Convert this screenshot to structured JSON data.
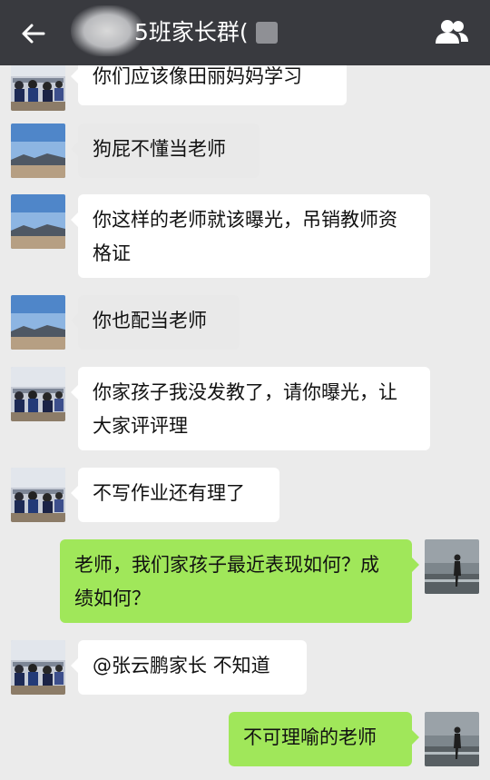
{
  "header": {
    "title": "5班家长群(",
    "back_icon": "back-arrow-icon",
    "members_icon": "group-members-icon"
  },
  "messages": [
    {
      "side": "left",
      "avatar": "classroom-avatar",
      "text": "你们应该像田丽妈妈学习"
    },
    {
      "side": "left",
      "avatar": "landscape-avatar",
      "text": "狗屁不懂当老师"
    },
    {
      "side": "left",
      "avatar": "landscape-avatar",
      "text": "你这样的老师就该曝光，吊销教师资格证"
    },
    {
      "side": "left",
      "avatar": "landscape-avatar",
      "text": "你也配当老师"
    },
    {
      "side": "left",
      "avatar": "classroom-avatar",
      "text": "你家孩子我没发教了，请你曝光，让大家评评理"
    },
    {
      "side": "left",
      "avatar": "classroom-avatar",
      "text": "不写作业还有理了"
    },
    {
      "side": "right",
      "avatar": "beach-avatar",
      "text": "老师，我们家孩子最近表现如何？成绩如何？"
    },
    {
      "side": "left",
      "avatar": "classroom-avatar",
      "text": "@张云鹏家长 不知道"
    },
    {
      "side": "right",
      "avatar": "beach-avatar",
      "text": "不可理喻的老师"
    }
  ],
  "colors": {
    "header_bg": "#393a3f",
    "chat_bg": "#ebebeb",
    "incoming_bubble": "#ffffff",
    "outgoing_bubble": "#a0e75a"
  }
}
